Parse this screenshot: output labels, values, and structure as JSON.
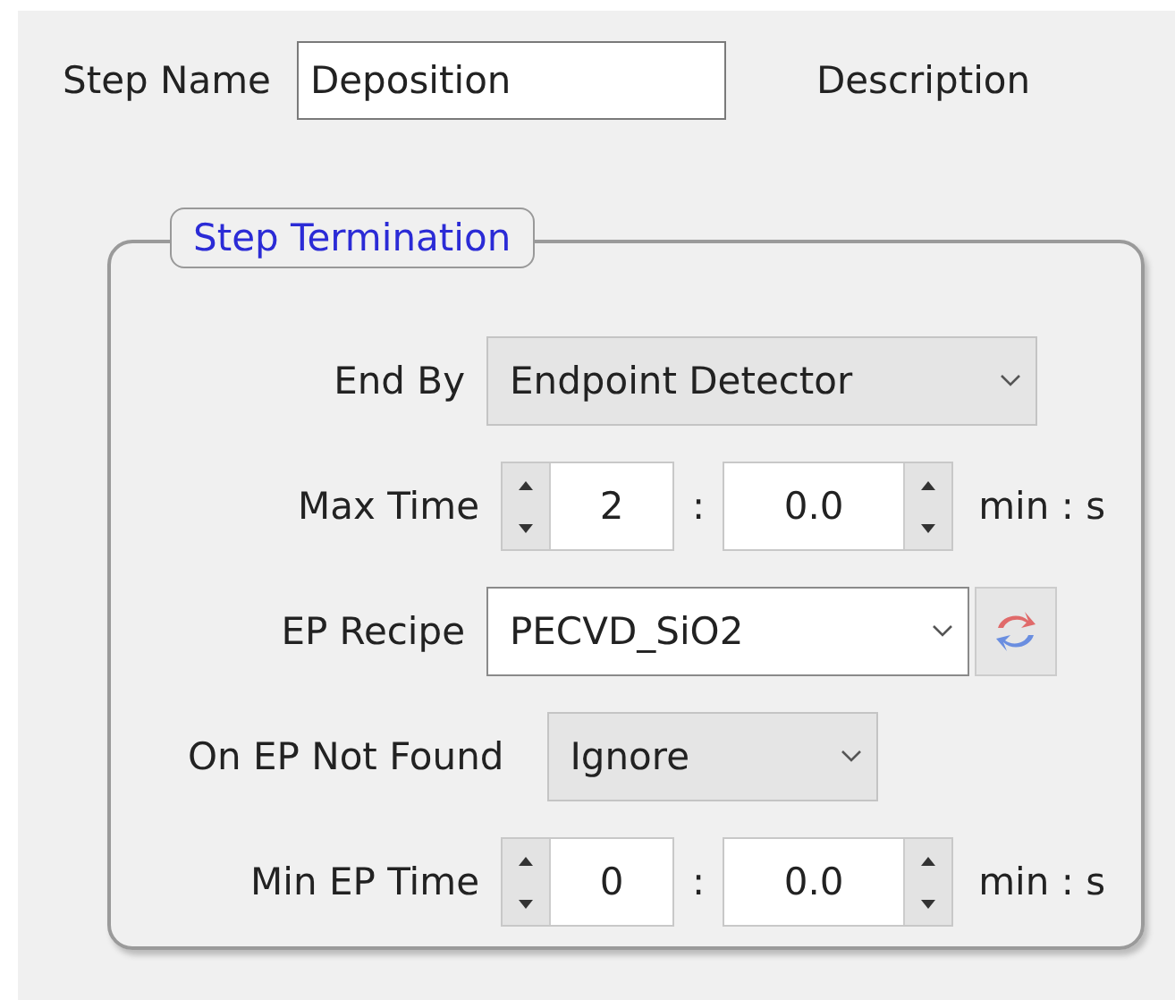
{
  "step_name": {
    "label": "Step Name",
    "value": "Deposition"
  },
  "description": {
    "label": "Description"
  },
  "group": {
    "title": "Step Termination",
    "rows": [
      {
        "kind": "select",
        "label": "End By",
        "value": "Endpoint Detector",
        "editable": false
      },
      {
        "kind": "time",
        "label": "Max Time",
        "minutes": "2",
        "separator": ":",
        "seconds": "0.0",
        "unit": "min : s"
      },
      {
        "kind": "recipe",
        "label": "EP Recipe",
        "value": "PECVD_SiO2",
        "editable": true
      },
      {
        "kind": "fallback",
        "label": "On EP Not Found",
        "value": "Ignore",
        "editable": false
      },
      {
        "kind": "time",
        "label": "Min EP Time",
        "minutes": "0",
        "separator": ":",
        "seconds": "0.0",
        "unit": "min : s"
      }
    ]
  }
}
